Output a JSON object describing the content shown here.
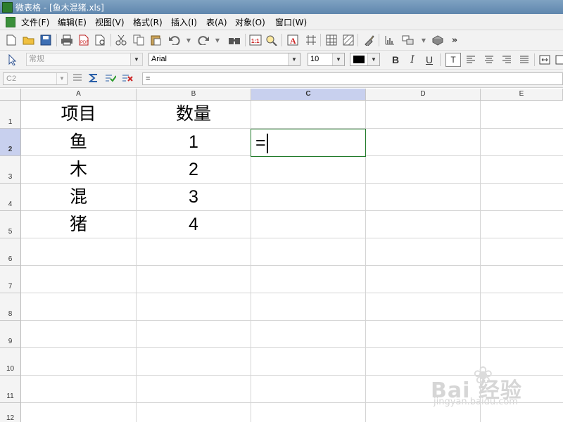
{
  "window": {
    "title": "微表格 - [鱼木混猪.xls]"
  },
  "menu": {
    "items": [
      {
        "label": "文件(F)"
      },
      {
        "label": "编辑(E)"
      },
      {
        "label": "视图(V)"
      },
      {
        "label": "格式(R)"
      },
      {
        "label": "插入(I)"
      },
      {
        "label": "表(A)"
      },
      {
        "label": "对象(O)"
      },
      {
        "label": "窗口(W)"
      }
    ]
  },
  "toolbar": {
    "icons": [
      "new-icon",
      "open-icon",
      "save-icon",
      "print-icon",
      "pdf-icon",
      "print-preview-icon",
      "cut-icon",
      "copy-icon",
      "paste-icon",
      "undo-icon",
      "redo-icon",
      "find-icon",
      "zoom-icon",
      "insert-text-icon",
      "grid-icon",
      "table-icon",
      "fill-icon",
      "chart-icon",
      "arrange-icon",
      "package-icon",
      "more-icon"
    ],
    "overflow_label": "»"
  },
  "format": {
    "style": "常规",
    "font": "Arial",
    "size": "10",
    "bold": "B",
    "italic": "I",
    "underline": "U",
    "font_color": "#000000"
  },
  "formula_bar": {
    "name_box": "C2",
    "content": "="
  },
  "grid": {
    "columns": [
      "A",
      "B",
      "C",
      "D",
      "E"
    ],
    "selected_column": "C",
    "rows": [
      "1",
      "2",
      "3",
      "4",
      "5",
      "6",
      "7",
      "8",
      "9",
      "10",
      "11",
      "12"
    ],
    "selected_row": "2",
    "cells": {
      "A1": "项目",
      "B1": "数量",
      "A2": "鱼",
      "B2": "1",
      "A3": "木",
      "B3": "2",
      "A4": "混",
      "B4": "3",
      "A5": "猪",
      "B5": "4"
    },
    "active_cell": {
      "ref": "C2",
      "value": "="
    }
  },
  "watermark": {
    "brand": "Bai 经验",
    "url": "jingyan.baidu.com"
  }
}
